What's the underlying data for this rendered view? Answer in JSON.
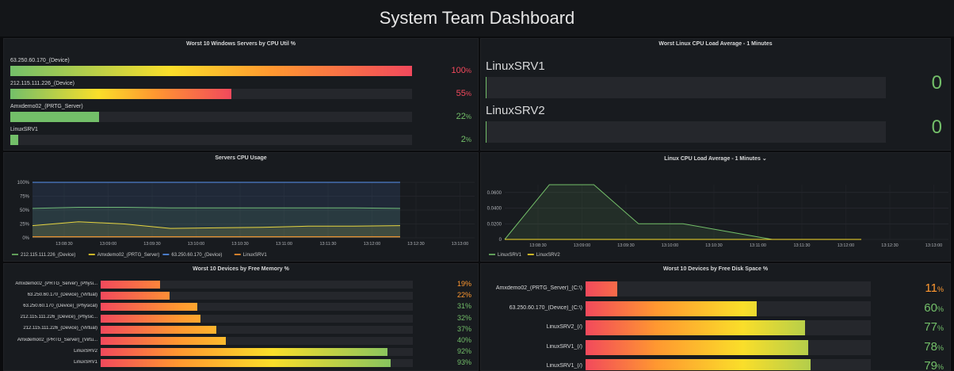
{
  "dashboard": {
    "title": "System Team Dashboard"
  },
  "colors": {
    "green": "#73bf69",
    "orange": "#ff9830",
    "red": "#f2495c",
    "yellow": "#fade2a",
    "blue": "#5794f2"
  },
  "cpu_util": {
    "title": "Worst 10 Windows Servers by CPU Util %",
    "rows": [
      {
        "label": "63.250.60.170_(Device)",
        "value": "100",
        "unit": "%",
        "pct": 1.0,
        "color": "red"
      },
      {
        "label": "212.115.111.226_(Device)",
        "value": "55",
        "unit": "%",
        "pct": 0.55,
        "color": "red"
      },
      {
        "label": "Amxdemo02_(PRTG_Server)",
        "value": "22",
        "unit": "%",
        "pct": 0.22,
        "color": "green"
      },
      {
        "label": "LinuxSRV1",
        "value": "2",
        "unit": "%",
        "pct": 0.02,
        "color": "green"
      }
    ]
  },
  "linux_load_stat": {
    "title": "Worst Linux CPU Load Average - 1 Minutes",
    "rows": [
      {
        "label": "LinuxSRV1",
        "value": "0"
      },
      {
        "label": "LinuxSRV2",
        "value": "0"
      }
    ]
  },
  "servers_cpu": {
    "title": "Servers CPU Usage",
    "chart_data": {
      "type": "line",
      "x": [
        "13:08:30",
        "13:09:00",
        "13:09:30",
        "13:10:00",
        "13:10:30",
        "13:11:00",
        "13:11:30",
        "13:12:00",
        "13:12:30",
        "13:13:00"
      ],
      "y_ticks": [
        "100%",
        "75%",
        "50%",
        "25%",
        "0%"
      ],
      "ylim": [
        0,
        100
      ],
      "series": [
        {
          "name": "212.115.111.226_(Device)",
          "color": "#73bf69",
          "values": [
            53,
            55,
            55,
            54,
            54,
            54,
            54,
            54,
            53
          ]
        },
        {
          "name": "Amxdemo02_(PRTG_Server)",
          "color": "#fade2a",
          "values": [
            22,
            29,
            25,
            17,
            18,
            19,
            21,
            21,
            22
          ]
        },
        {
          "name": "63.250.60.170_(Device)",
          "color": "#5794f2",
          "values": [
            100,
            100,
            100,
            100,
            100,
            100,
            100,
            100,
            100
          ]
        },
        {
          "name": "LinuxSRV1",
          "color": "#ff9830",
          "values": [
            2,
            2,
            2,
            2,
            2,
            2,
            2,
            2,
            2
          ]
        }
      ]
    }
  },
  "linux_cpu": {
    "title": "Linux CPU Load Average - 1 Minutes",
    "title_suffix": "⌄",
    "chart_data": {
      "type": "line",
      "x": [
        "13:08:30",
        "13:09:00",
        "13:09:30",
        "13:10:00",
        "13:10:30",
        "13:11:00",
        "13:11:30",
        "13:12:00",
        "13:12:30",
        "13:13:00"
      ],
      "y_ticks": [
        "0.0600",
        "0.0400",
        "0.0200",
        "0"
      ],
      "ylim": [
        0,
        0.07
      ],
      "series": [
        {
          "name": "LinuxSRV1",
          "color": "#73bf69",
          "values": [
            0,
            0.07,
            0.07,
            0.02,
            0.02,
            0.01,
            0,
            0,
            0
          ]
        },
        {
          "name": "LinuxSRV2",
          "color": "#fade2a",
          "values": [
            0,
            0,
            0,
            0,
            0,
            0,
            0,
            0,
            0
          ]
        }
      ]
    }
  },
  "memory": {
    "title": "Worst 10 Devices by Free Memory %",
    "rows": [
      {
        "label": "Amxdemo02_(PRTG_Server)_(Physi...",
        "value": "19%",
        "pct": 0.19,
        "color": "orange"
      },
      {
        "label": "63.250.60.170_(Device)_(Virtual)",
        "value": "22%",
        "pct": 0.22,
        "color": "orange"
      },
      {
        "label": "63.250.60.170_(Device)_(Physical)",
        "value": "31%",
        "pct": 0.31,
        "color": "green"
      },
      {
        "label": "212.115.111.226_(Device)_(Physic...",
        "value": "32%",
        "pct": 0.32,
        "color": "green"
      },
      {
        "label": "212.115.111.226_(Device)_(Virtual)",
        "value": "37%",
        "pct": 0.37,
        "color": "green"
      },
      {
        "label": "Amxdemo02_(PRTG_Server)_(Virtu...",
        "value": "40%",
        "pct": 0.4,
        "color": "green"
      },
      {
        "label": "LinuxSRV2",
        "value": "92%",
        "pct": 0.92,
        "color": "green"
      },
      {
        "label": "LinuxSRV1",
        "value": "93%",
        "pct": 0.93,
        "color": "green"
      }
    ]
  },
  "disk": {
    "title": "Worst 10 Devices by Free Disk Space %",
    "rows": [
      {
        "label": "Amxdemo02_(PRTG_Server)_(C:\\)",
        "value": "11",
        "unit": "%",
        "pct": 0.11,
        "color": "orange"
      },
      {
        "label": "63.250.60.170_(Device)_(C:\\)",
        "value": "60",
        "unit": "%",
        "pct": 0.6,
        "color": "green"
      },
      {
        "label": "LinuxSRV2_(/)",
        "value": "77",
        "unit": "%",
        "pct": 0.77,
        "color": "green"
      },
      {
        "label": "LinuxSRV1_(/)",
        "value": "78",
        "unit": "%",
        "pct": 0.78,
        "color": "green"
      },
      {
        "label": "LinuxSRV1_(/)",
        "value": "79",
        "unit": "%",
        "pct": 0.79,
        "color": "green"
      }
    ]
  }
}
